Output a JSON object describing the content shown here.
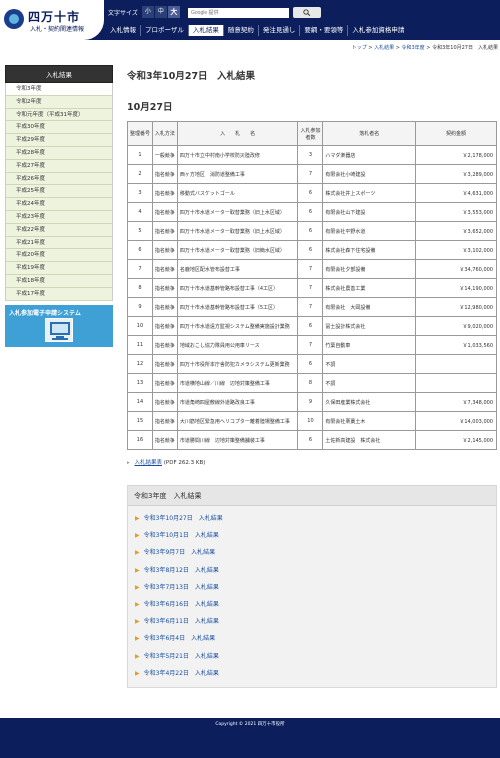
{
  "header": {
    "logo_title": "四万十市",
    "logo_sub": "入札・契約関連情報",
    "fontsize_label": "文字サイズ",
    "fontsize_buttons": [
      "小",
      "中",
      "大"
    ],
    "search_placeholder": "Google 提供",
    "nav": [
      "入札情報",
      "プロポーザル",
      "入札結果",
      "随意契約",
      "発注見通し",
      "要綱・要領等",
      "入札参加資格申請"
    ]
  },
  "breadcrumb": [
    "トップ",
    "入札結果",
    "令和3年度",
    "令和3年10月27日　入札結果"
  ],
  "breadcrumb_sep": ">",
  "sidebar": {
    "title": "入札結果",
    "items": [
      "令和3年度",
      "令和2年度",
      "令和元年度（平成31年度）",
      "平成30年度",
      "平成29年度",
      "平成28年度",
      "平成27年度",
      "平成26年度",
      "平成25年度",
      "平成24年度",
      "平成23年度",
      "平成22年度",
      "平成21年度",
      "平成20年度",
      "平成19年度",
      "平成18年度",
      "平成17年度"
    ],
    "banner_text": "入札参加電子申請システム"
  },
  "main": {
    "page_title": "令和3年10月27日　入札結果",
    "section_title": "10月27日",
    "table": {
      "headers": [
        "整理番号",
        "入札方法",
        "入　　札　　名",
        "入札参加者数",
        "落札者名",
        "契約金額"
      ],
      "rows": [
        [
          "1",
          "一般競争",
          "四万十市立中村南小学校防災陸改修",
          "3",
          "ハマダ楽器店",
          "￥2,178,000"
        ],
        [
          "2",
          "指名競争",
          "西ヶ方地区　消防道整備工事",
          "7",
          "有限会社小崎建設",
          "￥3,289,000"
        ],
        [
          "3",
          "指名競争",
          "移動式バスケットゴール",
          "6",
          "株式会社井上スポーツ",
          "￥4,631,000"
        ],
        [
          "4",
          "指名競争",
          "四万十市水道メーター取替業務（旧上水区域）",
          "6",
          "有限会社山下建設",
          "￥3,553,000"
        ],
        [
          "5",
          "指名競争",
          "四万十市水道メーター取替業務（旧上水区域）",
          "6",
          "有限会社平野水道",
          "￥3,652,000"
        ],
        [
          "6",
          "指名競争",
          "四万十市水道メーター取替業務（旧簡水区域）",
          "6",
          "株式会社森下住宅設備",
          "￥3,102,000"
        ],
        [
          "7",
          "指名競争",
          "名鹿地区配水管布設替工事",
          "7",
          "有限会社夕部設備",
          "￥34,760,000"
        ],
        [
          "8",
          "指名競争",
          "四万十市水道基幹管路布設替工事（4工区）",
          "7",
          "株式会社農善工業",
          "￥14,190,000"
        ],
        [
          "9",
          "指名競争",
          "四万十市水道基幹管路布設替工事（5工区）",
          "7",
          "有限会社　大岡設備",
          "￥12,980,000"
        ],
        [
          "10",
          "指名競争",
          "四万十市水道遠方監視システム整備実施設計業務",
          "6",
          "冨士設計株式会社",
          "￥9,020,000"
        ],
        [
          "11",
          "指名競争",
          "地域おこし協力隊員用公用車リース",
          "7",
          "竹葉自動車",
          "￥1,033,560"
        ],
        [
          "12",
          "指名競争",
          "四万十市役所本庁舎防犯カメラシステム更新業務",
          "6",
          "不調",
          ""
        ],
        [
          "13",
          "指名競争",
          "市道横地山線／川線　辺地対策整備工事",
          "8",
          "不調",
          ""
        ],
        [
          "14",
          "指名競争",
          "市道角崎四屋敷線外道路改良工事",
          "9",
          "久保田産業株式会社",
          "￥7,348,000"
        ],
        [
          "15",
          "指名競争",
          "大川筋地区緊急用ヘリコプター離着陸場整備工事",
          "10",
          "有限会社栗藁土木",
          "￥14,003,000"
        ],
        [
          "16",
          "指名競争",
          "市道勝間川線　辺地対策整備舗装工事",
          "6",
          "土佐新高建設　株式会社",
          "￥2,145,000"
        ]
      ]
    },
    "pdf_link": "入札結果表",
    "pdf_info": "(PDF 262.3 KB)",
    "year_box": {
      "title": "令和3年度　入札結果",
      "items": [
        "令和3年10月27日　入札結果",
        "令和3年10月1日　入札結果",
        "令和3年9月7日　入札結果",
        "令和3年8月12日　入札結果",
        "令和3年7月13日　入札結果",
        "令和3年6月16日　入札結果",
        "令和3年6月11日　入札結果",
        "令和3年6月4日　入札結果",
        "令和3年5月21日　入札結果",
        "令和3年4月22日　入札結果"
      ]
    }
  },
  "footer": {
    "copyright": "Copyright © 2021 四万十市役所"
  },
  "colors": {
    "navy": "#0c1f5c",
    "link": "#1a4fa0",
    "sidebar_bg": "#eef3de",
    "banner": "#3fa0d6"
  }
}
